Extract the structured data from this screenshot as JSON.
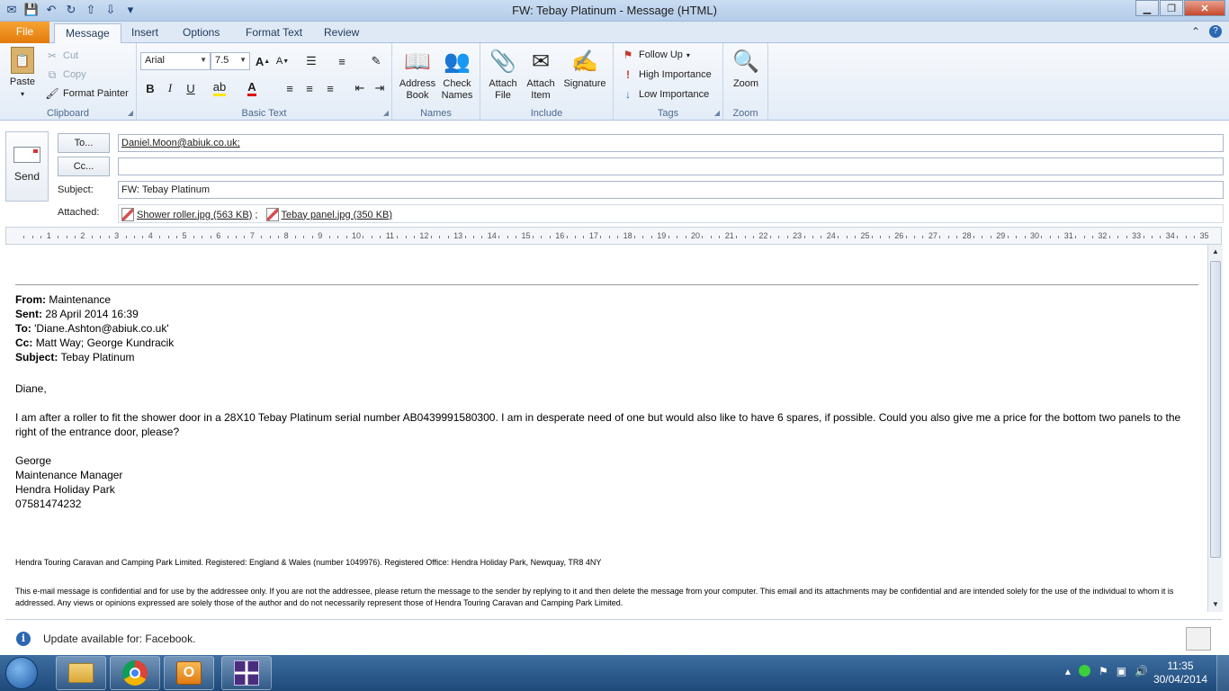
{
  "window": {
    "title": "FW: Tebay Platinum  -  Message (HTML)"
  },
  "tabs": {
    "file": "File",
    "message": "Message",
    "insert": "Insert",
    "options": "Options",
    "format_text": "Format Text",
    "review": "Review"
  },
  "ribbon": {
    "clipboard": {
      "paste": "Paste",
      "cut": "Cut",
      "copy": "Copy",
      "format_painter": "Format Painter",
      "label": "Clipboard"
    },
    "basic_text": {
      "font": "Arial",
      "size": "7.5",
      "bold": "B",
      "italic": "I",
      "underline": "U",
      "label": "Basic Text"
    },
    "names": {
      "address_book": "Address Book",
      "check_names": "Check Names",
      "label": "Names"
    },
    "include": {
      "attach_file": "Attach File",
      "attach_item": "Attach Item",
      "signature": "Signature",
      "label": "Include"
    },
    "tags": {
      "follow_up": "Follow Up",
      "high_importance": "High Importance",
      "low_importance": "Low Importance",
      "label": "Tags"
    },
    "zoom": {
      "zoom": "Zoom",
      "label": "Zoom"
    }
  },
  "header": {
    "send": "Send",
    "to_button": "To...",
    "cc_button": "Cc...",
    "to_value": "Daniel.Moon@abiuk.co.uk;",
    "cc_value": "",
    "subject_label": "Subject:",
    "subject_value": "FW: Tebay Platinum",
    "attached_label": "Attached:",
    "attachments": [
      {
        "name": "Shower roller.jpg (563 KB)",
        "sep": ";"
      },
      {
        "name": "Tebay panel.jpg (350 KB)",
        "sep": ""
      }
    ]
  },
  "ruler": {
    "numbers": [
      "1",
      "2",
      "3",
      "4",
      "5",
      "6",
      "7",
      "8",
      "9",
      "10",
      "11",
      "12",
      "13",
      "14",
      "15",
      "16",
      "17",
      "18",
      "19",
      "20",
      "21",
      "22",
      "23",
      "24",
      "25",
      "26",
      "27",
      "28",
      "29",
      "30",
      "31",
      "32",
      "33",
      "34",
      "35"
    ]
  },
  "body": {
    "from_label": "From:",
    "from": "Maintenance",
    "sent_label": "Sent:",
    "sent": "28 April 2014 16:39",
    "to_label": "To:",
    "to": "'Diane.Ashton@abiuk.co.uk'",
    "cc_label": "Cc:",
    "cc": "Matt Way; George Kundracik",
    "subject_label": "Subject:",
    "subject": "Tebay Platinum",
    "greeting": "Diane,",
    "paragraph": "I am after a roller to fit the shower door in a 28X10 Tebay Platinum serial number AB0439991580300. I am in desperate need of one but would also like to have 6 spares, if possible. Could you also give me a price for the bottom two panels to the right of the entrance door, please?",
    "sig_name": "George",
    "sig_title": "Maintenance Manager",
    "sig_company": "Hendra Holiday Park",
    "sig_phone": "07581474232",
    "footer1": "Hendra Touring Caravan and Camping Park Limited. Registered: England & Wales (number 1049976). Registered Office: Hendra Holiday Park, Newquay, TR8 4NY",
    "footer2": "This e-mail message is confidential and for use by the addressee only. If you are not the addressee, please return the message to the sender by replying to it and then delete the message from your computer. This email and its attachments may be confidential and are intended solely for the use of the individual to whom it is addressed. Any views or opinions expressed are solely those of the author and do not necessarily represent those of Hendra Touring Caravan and Camping Park Limited."
  },
  "infobar": {
    "text": "Update available for: Facebook."
  },
  "taskbar": {
    "time": "11:35",
    "date": "30/04/2014"
  }
}
